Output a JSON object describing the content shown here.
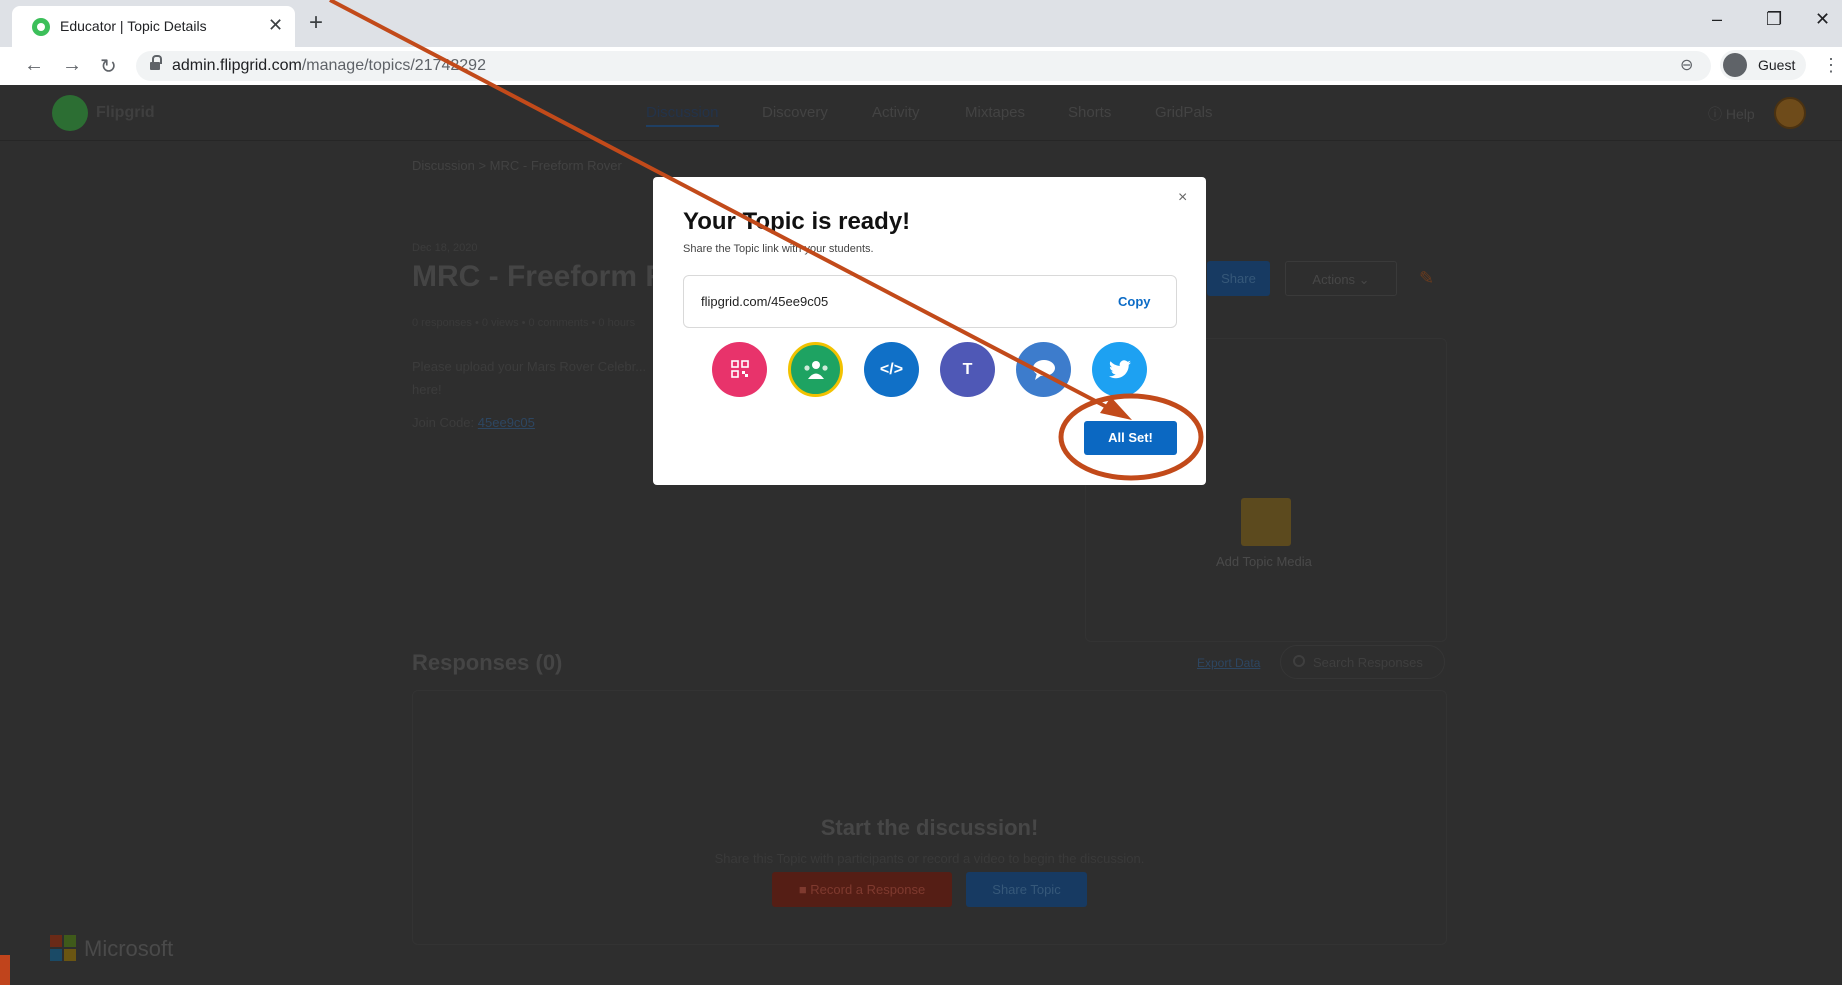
{
  "browser": {
    "tab_title": "Educator | Topic Details",
    "tab_close": "✕",
    "new_tab": "+",
    "url_domain": "admin.flipgrid.com",
    "url_path": "/manage/topics/21742292",
    "profile_label": "Guest",
    "window_controls": [
      "–",
      "❐",
      "✕"
    ]
  },
  "app": {
    "brand": "Flipgrid",
    "nav": [
      "Discussion",
      "Discovery",
      "Activity",
      "Mixtapes",
      "Shorts",
      "GridPals"
    ],
    "help": "Help"
  },
  "topic": {
    "breadcrumb": "Discussion  >  MRC - Freeform Rover",
    "date": "Dec 18, 2020",
    "title": "MRC - Freeform R",
    "stats": "0 responses • 0 views • 0 comments • 0 hours",
    "prompt": "Please upload your Mars Rover Celebr... here!",
    "join_label": "Join Code:",
    "join_code": "45ee9c05",
    "share_label": "Share",
    "actions_label": "Actions ⌄",
    "add_media_label": "Add Topic Media"
  },
  "responses": {
    "title": "Responses (0)",
    "export_label": "Export Data",
    "search_placeholder": "Search Responses",
    "empty_title": "Start the discussion!",
    "empty_sub": "Share this Topic with participants or record a video to begin the discussion.",
    "record_label": "Record a Response",
    "share_topic_label": "Share Topic"
  },
  "footer": {
    "brand": "Microsoft"
  },
  "modal": {
    "close": "×",
    "title": "Your Topic is ready!",
    "subtitle": "Share the Topic link with your students.",
    "link": "flipgrid.com/45ee9c05",
    "copy_label": "Copy",
    "share_targets": [
      "qr-code",
      "google-classroom",
      "embed-code",
      "microsoft-teams",
      "remind",
      "twitter"
    ],
    "embed_glyph": "</>",
    "teams_glyph": "T",
    "all_set_label": "All Set!"
  },
  "colors": {
    "annotation": "#c24a1a",
    "primary_blue": "#0b68c2",
    "qr": "#e8336b",
    "classroom": "#1ea362",
    "embed": "#1070c7",
    "teams": "#4f58b6",
    "remind": "#3d7ccc",
    "twitter": "#1da1f2"
  }
}
